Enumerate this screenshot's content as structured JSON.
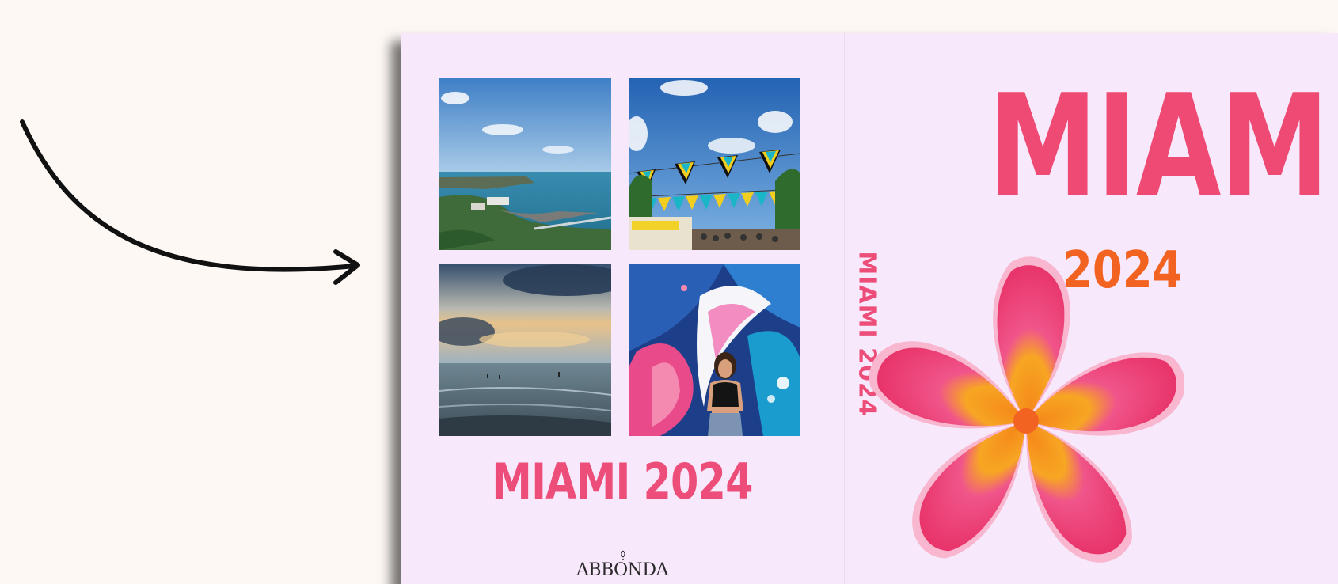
{
  "back_cover": {
    "title": "MIAMI 2024",
    "logo": "ABBONDA",
    "photos": [
      {
        "icon": "coastline-photo"
      },
      {
        "icon": "flags-photo"
      },
      {
        "icon": "beach-sunset-photo"
      },
      {
        "icon": "mural-portrait-photo"
      }
    ]
  },
  "spine": {
    "title": "MIAMI 2024"
  },
  "front_cover": {
    "title": "MIAMI",
    "year": "2024",
    "icon": "plumeria-flower-icon"
  },
  "colors": {
    "background": "#fdf8f4",
    "cover": "#f8e8fb",
    "title_pink": "#ee4a74",
    "year_orange": "#f26322"
  }
}
